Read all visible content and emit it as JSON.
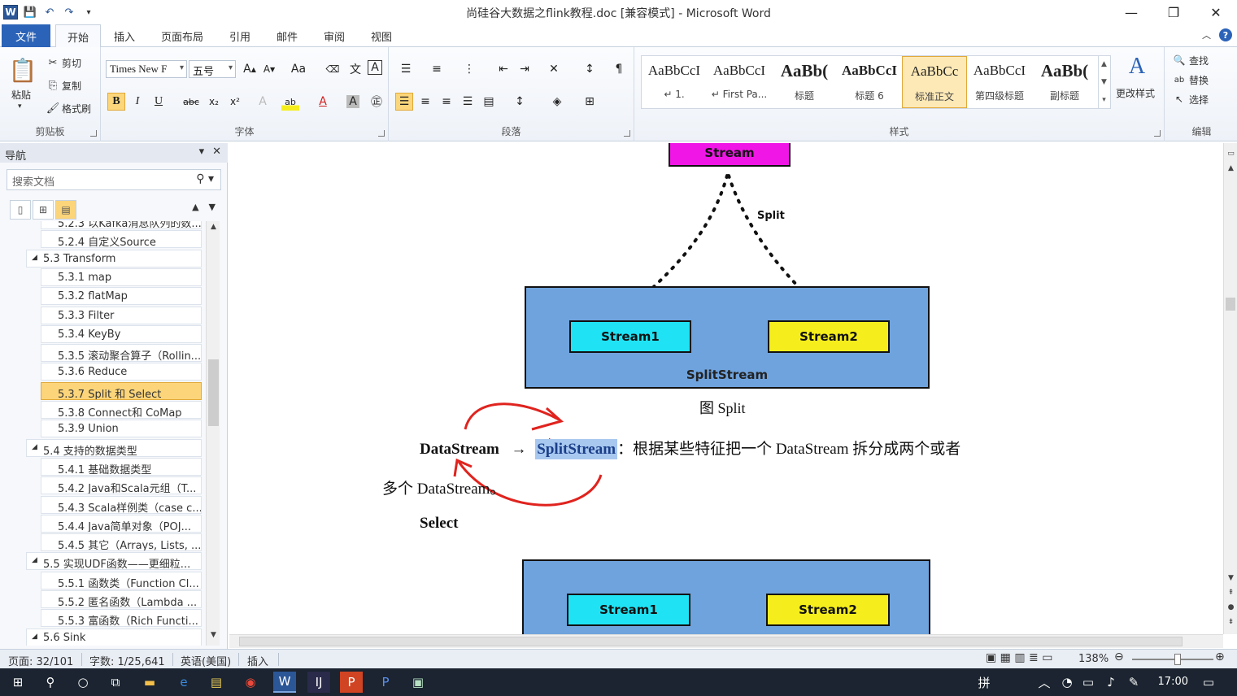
{
  "window": {
    "title": "尚硅谷大数据之flink教程.doc [兼容模式] - Microsoft Word",
    "app_icon": "W",
    "controls": [
      "minimize",
      "restore",
      "close"
    ]
  },
  "ribbon_tabs": [
    {
      "label": "文件"
    },
    {
      "label": "开始"
    },
    {
      "label": "插入"
    },
    {
      "label": "页面布局"
    },
    {
      "label": "引用"
    },
    {
      "label": "邮件"
    },
    {
      "label": "审阅"
    },
    {
      "label": "视图"
    }
  ],
  "clipboard": {
    "paste": "粘贴",
    "cut": "剪切",
    "copy": "复制",
    "format_painter": "格式刷",
    "group_label": "剪贴板"
  },
  "font": {
    "font_name": "Times New F",
    "font_size": "五号",
    "group_label": "字体"
  },
  "paragraph": {
    "group_label": "段落"
  },
  "styles": {
    "items": [
      {
        "sample": "AaBbCcI",
        "name": "↵ 1.",
        "big": false
      },
      {
        "sample": "AaBbCcI",
        "name": "↵ First Pa...",
        "big": false
      },
      {
        "sample": "AaBb(",
        "name": "标题",
        "big": true
      },
      {
        "sample": "AaBbCcI",
        "name": "标题 6",
        "big": false,
        "bold": true
      },
      {
        "sample": "AaBbCc",
        "name": "标准正文",
        "big": false,
        "selected": true
      },
      {
        "sample": "AaBbCcI",
        "name": "第四级标题",
        "big": false
      },
      {
        "sample": "AaBb(",
        "name": "副标题",
        "big": true
      }
    ],
    "change_styles": "更改样式",
    "group_label": "样式"
  },
  "editing": {
    "find": "查找",
    "replace": "替换",
    "select": "选择",
    "group_label": "编辑"
  },
  "nav": {
    "title": "导航",
    "search_placeholder": "搜索文档",
    "items": [
      {
        "level": 3,
        "label": "5.2.3 以Kafka消息队列的数..."
      },
      {
        "level": 3,
        "label": "5.2.4 自定义Source"
      },
      {
        "level": 2,
        "label": "5.3 Transform"
      },
      {
        "level": 3,
        "label": "5.3.1 map"
      },
      {
        "level": 3,
        "label": "5.3.2 flatMap"
      },
      {
        "level": 3,
        "label": "5.3.3 Filter"
      },
      {
        "level": 3,
        "label": "5.3.4 KeyBy"
      },
      {
        "level": 3,
        "label": "5.3.5 滚动聚合算子（Rollin..."
      },
      {
        "level": 3,
        "label": "5.3.6 Reduce"
      },
      {
        "level": 3,
        "label": "5.3.7 Split 和 Select",
        "active": true
      },
      {
        "level": 3,
        "label": "5.3.8 Connect和 CoMap"
      },
      {
        "level": 3,
        "label": "5.3.9 Union"
      },
      {
        "level": 2,
        "label": "5.4 支持的数据类型"
      },
      {
        "level": 3,
        "label": "5.4.1 基础数据类型"
      },
      {
        "level": 3,
        "label": "5.4.2 Java和Scala元组（T..."
      },
      {
        "level": 3,
        "label": "5.4.3 Scala样例类（case c..."
      },
      {
        "level": 3,
        "label": "5.4.4 Java简单对象（POJ..."
      },
      {
        "level": 3,
        "label": "5.4.5 其它（Arrays, Lists, ..."
      },
      {
        "level": 2,
        "label": "5.5 实现UDF函数——更细粒..."
      },
      {
        "level": 3,
        "label": "5.5.1 函数类（Function Cl..."
      },
      {
        "level": 3,
        "label": "5.5.2 匿名函数（Lambda ..."
      },
      {
        "level": 3,
        "label": "5.5.3 富函数（Rich Functi..."
      },
      {
        "level": 2,
        "label": "5.6 Sink"
      }
    ]
  },
  "document": {
    "top_box": "Stream",
    "split_label": "Split",
    "stream1": "Stream1",
    "stream2": "Stream2",
    "splitstream": "SplitStream",
    "caption": "图  Split",
    "line1_a": "DataStream",
    "line1_arrow": "→",
    "line1_hl": "SplitStream",
    "line1_b": "：根据某些特征把一个 DataStream 拆分成两个或者",
    "line2": "多个 DataStream。",
    "select_heading": "Select",
    "stream1_b": "Stream1",
    "stream2_b": "Stream2",
    "colors": {
      "magenta": "#f016e6",
      "blue_container": "#6fa3dd",
      "cyan": "#1fe3f5",
      "yellow": "#f6ee1c",
      "annotation_red": "#e0231e",
      "highlight": "#a8c8ef"
    }
  },
  "status": {
    "page": "页面: 32/101",
    "words": "字数: 1/25,641",
    "language": "英语(美国)",
    "mode": "插入",
    "zoom": "138%"
  },
  "taskbar": {
    "time": "17:00",
    "ime": "拼"
  }
}
